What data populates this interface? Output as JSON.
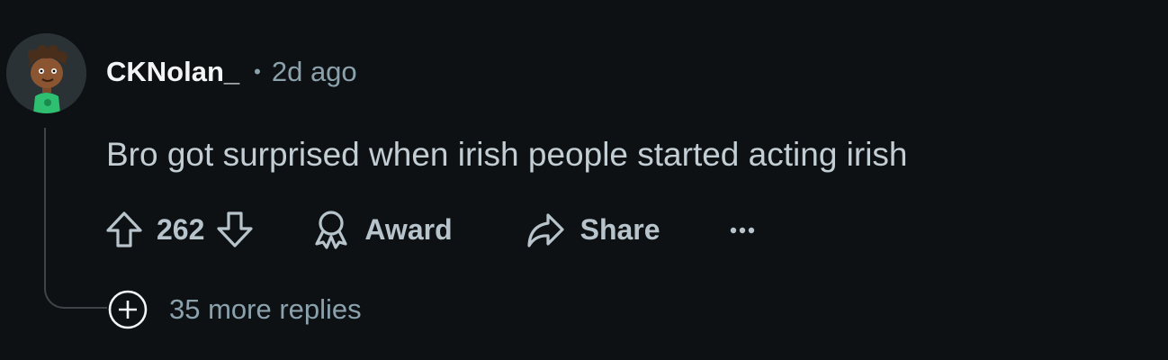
{
  "comment": {
    "username": "CKNolan_",
    "separator": "•",
    "time_ago": "2d ago",
    "body": "Bro got surprised when irish people started acting irish",
    "score": "262"
  },
  "actions": {
    "upvote_icon": "arrow-up-icon",
    "downvote_icon": "arrow-down-icon",
    "award_label": "Award",
    "award_icon": "award-icon",
    "share_label": "Share",
    "share_icon": "share-icon",
    "more_icon": "ellipsis-icon"
  },
  "replies": {
    "label": "35 more replies",
    "icon": "plus-circle-icon"
  },
  "colors": {
    "background": "#0e1113",
    "username": "#f2f4f5",
    "meta": "#8ba2ad",
    "body": "#c3ced4",
    "actions": "#b7c4cb",
    "thread_line": "#3e4447"
  }
}
